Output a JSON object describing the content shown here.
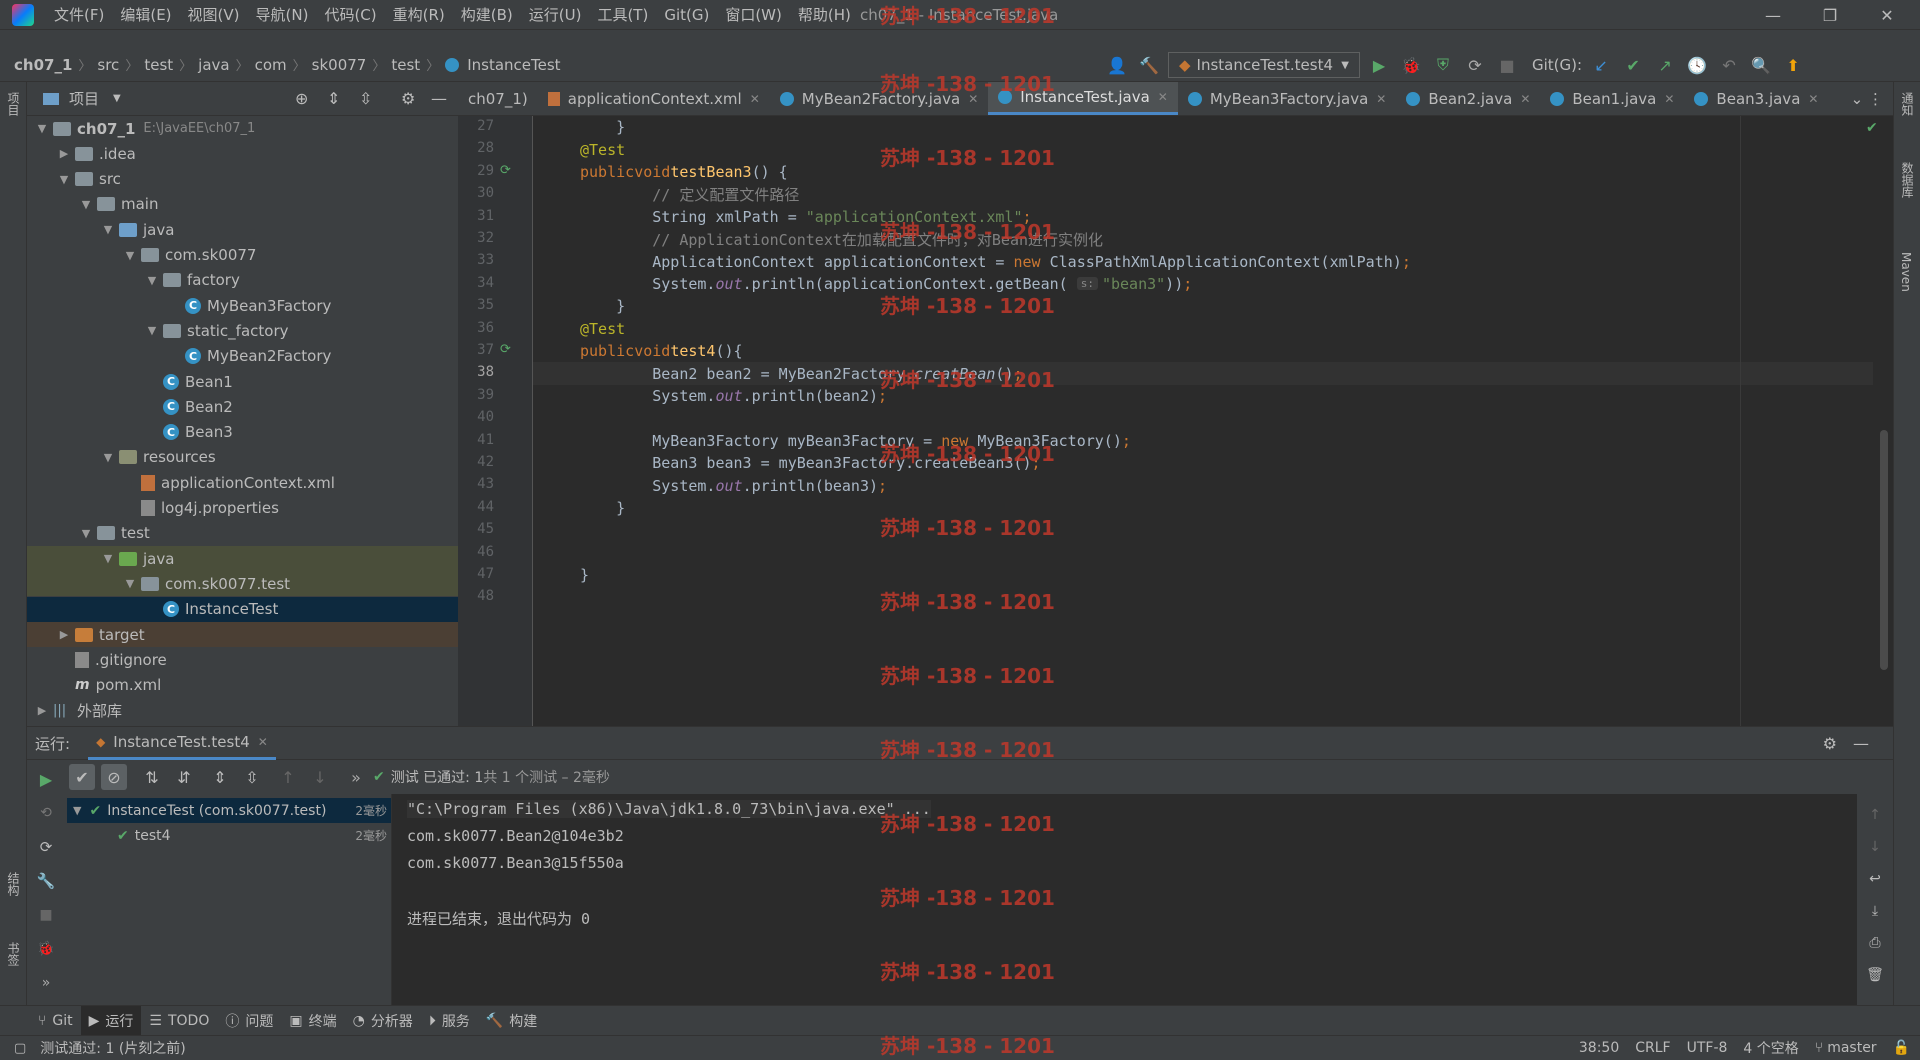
{
  "menubar": {
    "items": [
      "文件(F)",
      "编辑(E)",
      "视图(V)",
      "导航(N)",
      "代码(C)",
      "重构(R)",
      "构建(B)",
      "运行(U)",
      "工具(T)",
      "Git(G)",
      "窗口(W)",
      "帮助(H)"
    ],
    "window_title": "ch07_1 - InstanceTest.java"
  },
  "navbar": {
    "breadcrumbs": [
      "ch07_1",
      "src",
      "test",
      "java",
      "com",
      "sk0077",
      "test",
      "InstanceTest"
    ],
    "run_config": "InstanceTest.test4",
    "git_label": "Git(G):"
  },
  "left_strip": {
    "project": "项目",
    "structure": "结构",
    "bookmarks": "书签"
  },
  "right_strip": {
    "notifications": "通知",
    "database": "数据库",
    "maven": "Maven"
  },
  "project": {
    "title": "项目",
    "tree": [
      {
        "label": "ch07_1",
        "extra": "E:\\JavaEE\\ch07_1",
        "depth": 0,
        "icon": "module",
        "open": true
      },
      {
        "label": ".idea",
        "depth": 1,
        "icon": "folder",
        "open": false
      },
      {
        "label": "src",
        "depth": 1,
        "icon": "folder",
        "open": true
      },
      {
        "label": "main",
        "depth": 2,
        "icon": "folder",
        "open": true
      },
      {
        "label": "java",
        "depth": 3,
        "icon": "folder-blue",
        "open": true
      },
      {
        "label": "com.sk0077",
        "depth": 4,
        "icon": "package",
        "open": true
      },
      {
        "label": "factory",
        "depth": 5,
        "icon": "package",
        "open": true
      },
      {
        "label": "MyBean3Factory",
        "depth": 6,
        "icon": "class"
      },
      {
        "label": "static_factory",
        "depth": 5,
        "icon": "package",
        "open": true
      },
      {
        "label": "MyBean2Factory",
        "depth": 6,
        "icon": "class"
      },
      {
        "label": "Bean1",
        "depth": 5,
        "icon": "class"
      },
      {
        "label": "Bean2",
        "depth": 5,
        "icon": "class"
      },
      {
        "label": "Bean3",
        "depth": 5,
        "icon": "class"
      },
      {
        "label": "resources",
        "depth": 3,
        "icon": "folder-res",
        "open": true
      },
      {
        "label": "applicationContext.xml",
        "depth": 4,
        "icon": "xml"
      },
      {
        "label": "log4j.properties",
        "depth": 4,
        "icon": "props"
      },
      {
        "label": "test",
        "depth": 2,
        "icon": "folder",
        "open": true
      },
      {
        "label": "java",
        "depth": 3,
        "icon": "folder-green",
        "open": true,
        "hl": true
      },
      {
        "label": "com.sk0077.test",
        "depth": 4,
        "icon": "package",
        "open": true,
        "hl": true
      },
      {
        "label": "InstanceTest",
        "depth": 5,
        "icon": "class",
        "sel": true
      },
      {
        "label": "target",
        "depth": 1,
        "icon": "folder-orange",
        "open": false,
        "tgt": true
      },
      {
        "label": ".gitignore",
        "depth": 1,
        "icon": "props"
      },
      {
        "label": "pom.xml",
        "depth": 1,
        "icon": "maven"
      },
      {
        "label": "外部库",
        "depth": 0,
        "icon": "lib",
        "open": false
      }
    ]
  },
  "tabs": [
    {
      "label": "ch07_1)",
      "icon": "none"
    },
    {
      "label": "applicationContext.xml",
      "icon": "xml"
    },
    {
      "label": "MyBean2Factory.java",
      "icon": "class"
    },
    {
      "label": "InstanceTest.java",
      "icon": "class",
      "active": true
    },
    {
      "label": "MyBean3Factory.java",
      "icon": "class"
    },
    {
      "label": "Bean2.java",
      "icon": "class"
    },
    {
      "label": "Bean1.java",
      "icon": "class"
    },
    {
      "label": "Bean3.java",
      "icon": "class"
    }
  ],
  "editor": {
    "current_line": 38,
    "lines": [
      {
        "n": 27,
        "code": "    }"
      },
      {
        "n": 28,
        "code": "    @Test"
      },
      {
        "n": 29,
        "code": "    public void testBean3() {",
        "run": true
      },
      {
        "n": 30,
        "code": "        // 定义配置文件路径"
      },
      {
        "n": 31,
        "code": "        String xmlPath = \"applicationContext.xml\";"
      },
      {
        "n": 32,
        "code": "        // ApplicationContext在加载配置文件时，对Bean进行实例化"
      },
      {
        "n": 33,
        "code": "        ApplicationContext applicationContext = new ClassPathXmlApplicationContext(xmlPath);"
      },
      {
        "n": 34,
        "code": "        System.out.println(applicationContext.getBean( s: \"bean3\"));"
      },
      {
        "n": 35,
        "code": "    }"
      },
      {
        "n": 36,
        "code": "    @Test"
      },
      {
        "n": 37,
        "code": "    public void test4(){",
        "run": true
      },
      {
        "n": 38,
        "code": "        Bean2 bean2 = MyBean2Factory.creatBean();"
      },
      {
        "n": 39,
        "code": "        System.out.println(bean2);"
      },
      {
        "n": 40,
        "code": ""
      },
      {
        "n": 41,
        "code": "        MyBean3Factory myBean3Factory = new MyBean3Factory();"
      },
      {
        "n": 42,
        "code": "        Bean3 bean3 = myBean3Factory.createBean3();"
      },
      {
        "n": 43,
        "code": "        System.out.println(bean3);"
      },
      {
        "n": 44,
        "code": "    }"
      },
      {
        "n": 45,
        "code": ""
      },
      {
        "n": 46,
        "code": ""
      },
      {
        "n": 47,
        "code": "}"
      },
      {
        "n": 48,
        "code": ""
      }
    ]
  },
  "run": {
    "label": "运行:",
    "tab": "InstanceTest.test4",
    "status_prefix": "测试 已通过: ",
    "status_count": "1",
    "status_suffix": "共 1 个测试 – 2毫秒",
    "tree": [
      {
        "label": "InstanceTest (com.sk0077.test)",
        "time": "2毫秒",
        "sel": true
      },
      {
        "label": "test4",
        "time": "2毫秒"
      }
    ],
    "console": [
      "\"C:\\Program Files (x86)\\Java\\jdk1.8.0_73\\bin\\java.exe\" ...",
      "com.sk0077.Bean2@104e3b2",
      "com.sk0077.Bean3@15f550a",
      "",
      "进程已结束，退出代码为 0"
    ]
  },
  "bottom_tools": [
    {
      "label": "Git",
      "icon": "git-icon"
    },
    {
      "label": "运行",
      "icon": "run-icon",
      "active": true
    },
    {
      "label": "TODO",
      "icon": "todo-icon"
    },
    {
      "label": "问题",
      "icon": "problems-icon"
    },
    {
      "label": "终端",
      "icon": "terminal-icon"
    },
    {
      "label": "分析器",
      "icon": "profiler-icon"
    },
    {
      "label": "服务",
      "icon": "services-icon"
    },
    {
      "label": "构建",
      "icon": "build-icon"
    }
  ],
  "status": {
    "message": "测试通过: 1 (片刻之前)",
    "position": "38:50",
    "line_sep": "CRLF",
    "encoding": "UTF-8",
    "indent": "4 个空格",
    "branch": "master"
  },
  "watermark": "苏坤 -138 - 1201"
}
